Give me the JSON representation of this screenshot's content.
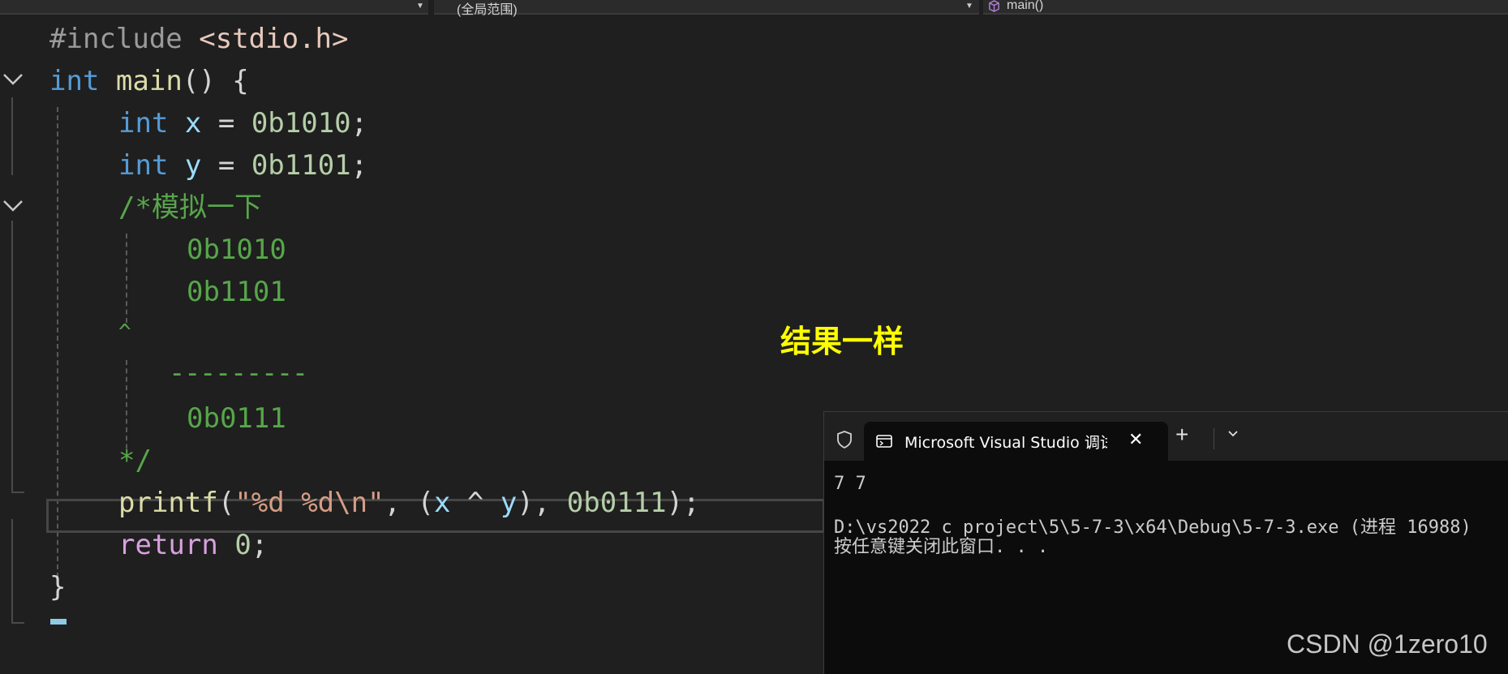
{
  "navbar": {
    "scope_label": "(全局范围)",
    "function_label": "main()"
  },
  "code": {
    "include_kw": "#include",
    "include_file": "<stdio.h>",
    "int_kw": "int",
    "main_fn": "main",
    "return_kw": "return",
    "printf_fn": "printf",
    "var_x": "x",
    "var_y": "y",
    "val_x": "0b1010",
    "val_y": "0b1101",
    "comment_start": "/*模拟一下",
    "comment_op": "^",
    "comment_rule": "---------",
    "comment_result": "0b0111",
    "comment_end": "*/",
    "format_string": "\"%d %d\\n\"",
    "printf_literal": "0b0111",
    "return_value": "0"
  },
  "annotation": {
    "text": "结果一样",
    "color": "#ffff00"
  },
  "console": {
    "tab_title": "Microsoft Visual Studio 调试控",
    "output_lines": [
      "7 7",
      "",
      "D:\\vs2022 c project\\5\\5-7-3\\x64\\Debug\\5-7-3.exe (进程 16988)",
      "按任意键关闭此窗口. . ."
    ]
  },
  "watermark": "CSDN @1zero10",
  "colors": {
    "keyword": "#569cd6",
    "control_keyword": "#d8a0df",
    "function": "#dcdcaa",
    "variable": "#9cdcfe",
    "number": "#b5cea8",
    "string": "#d69d85",
    "comment": "#57a64a",
    "background": "#1f1f1f"
  },
  "icons": {
    "navbar": [
      "dropdown-arrow-icon",
      "cube-icon"
    ],
    "editor": [
      "fold-chevron-icon"
    ],
    "console": [
      "shield-icon",
      "terminal-icon",
      "close-icon",
      "plus-icon",
      "chevron-down-icon"
    ]
  }
}
